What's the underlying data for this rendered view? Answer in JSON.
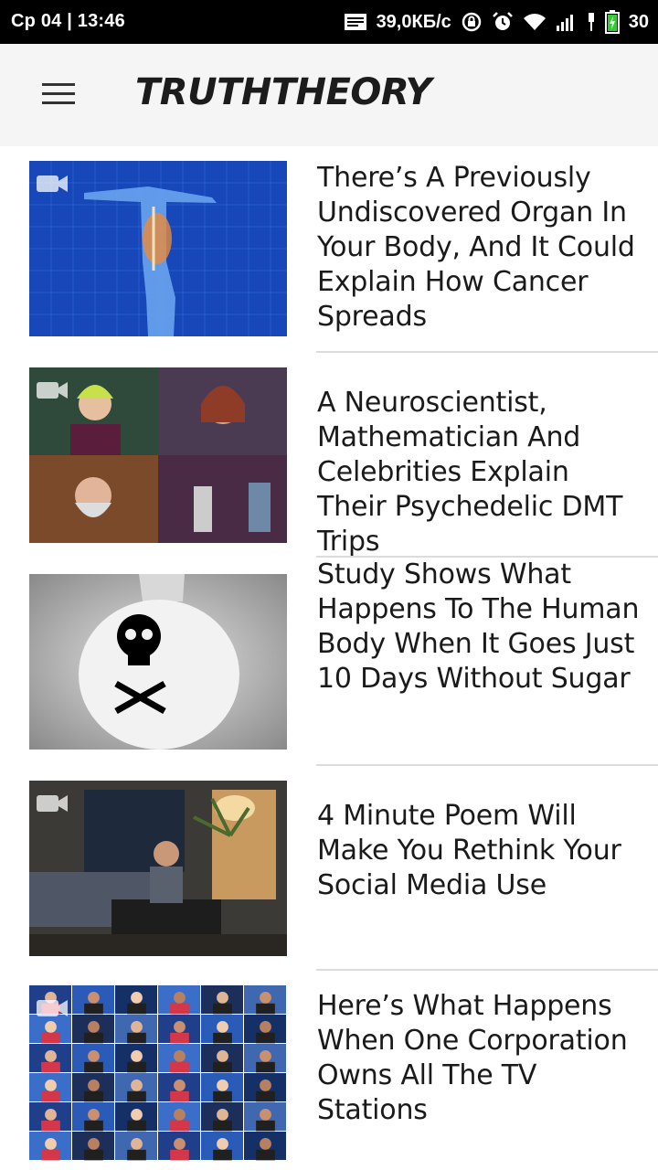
{
  "status_bar": {
    "time": "Ср 04 | 13:46",
    "speed": "39,0КБ/с",
    "battery": "30"
  },
  "app_bar": {
    "logo": "TRUTHTHEORY"
  },
  "articles": [
    {
      "title": "There’s A Previously Undiscovered Organ In Your Body, And It Could Explain How Cancer Spreads",
      "video": true
    },
    {
      "title": "A Neuroscientist, Mathematician And Celebrities Explain Their Psychedelic DMT Trips",
      "video": true
    },
    {
      "title": "Study Shows What Happens To The Human Body When It Goes Just 10 Days Without Sugar",
      "video": false
    },
    {
      "title": "4 Minute Poem Will Make You Rethink Your Social Media Use",
      "video": true
    },
    {
      "title": "Here’s What Happens When One Corporation Owns All The TV Stations",
      "video": true
    }
  ]
}
